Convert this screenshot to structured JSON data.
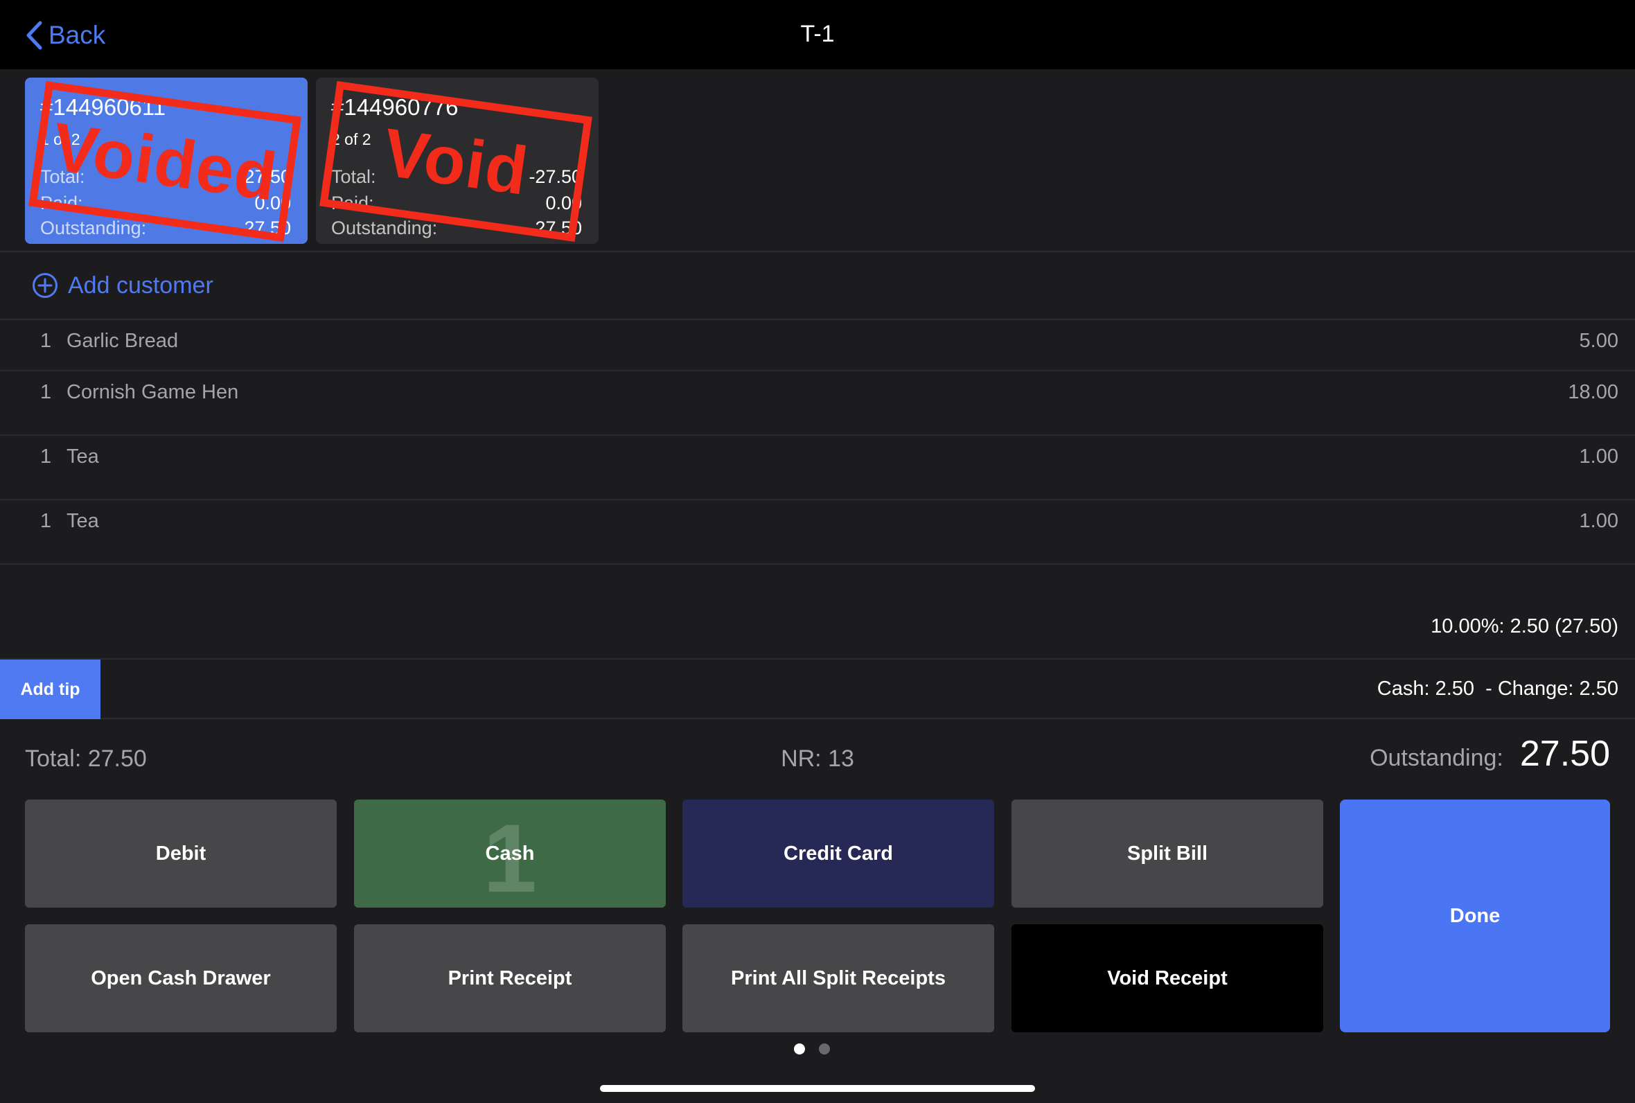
{
  "nav": {
    "back_label": "Back",
    "title": "T-1"
  },
  "receipts": [
    {
      "number": "#144960611",
      "of_label": "1 of 2",
      "total_label": "Total:",
      "total": "27.50",
      "paid_label": "Paid:",
      "paid": "0.00",
      "outstanding_label": "Outstanding:",
      "outstanding": "27.50",
      "stamp": "Voided",
      "selected": true
    },
    {
      "number": "#144960776",
      "of_label": "2 of 2",
      "total_label": "Total:",
      "total": "-27.50",
      "paid_label": "Paid:",
      "paid": "0.00",
      "outstanding_label": "Outstanding:",
      "outstanding": "-27.50",
      "stamp": "Void",
      "selected": false
    }
  ],
  "customer": {
    "add_label": "Add customer"
  },
  "items": [
    {
      "qty": "1",
      "name": "Garlic Bread",
      "price": "5.00"
    },
    {
      "qty": "1",
      "name": "Cornish Game Hen",
      "price": "18.00"
    },
    {
      "qty": "1",
      "name": "Tea",
      "price": "1.00"
    },
    {
      "qty": "1",
      "name": "Tea",
      "price": "1.00"
    }
  ],
  "tax_line": "10.00%: 2.50 (27.50)",
  "tip": {
    "add_label": "Add tip",
    "cash_change": "Cash: 2.50  - Change: 2.50"
  },
  "summary": {
    "total_text": "Total:  27.50",
    "nr_text": "NR: 13",
    "outstanding_label": "Outstanding:",
    "outstanding_value": "27.50"
  },
  "buttons": {
    "debit": "Debit",
    "cash": "Cash",
    "cash_badge": "1",
    "credit_card": "Credit Card",
    "split_bill": "Split Bill",
    "open_cash_drawer": "Open Cash Drawer",
    "print_receipt": "Print Receipt",
    "print_all_split": "Print All Split Receipts",
    "void_receipt": "Void Receipt",
    "done": "Done"
  },
  "pagination": {
    "current": 1,
    "total": 2
  },
  "colors": {
    "accent": "#4f7af2",
    "stamp_red": "#f22b1b",
    "cash_green": "#3e6b45",
    "credit_navy": "#262856",
    "done_blue": "#4a76f4"
  }
}
